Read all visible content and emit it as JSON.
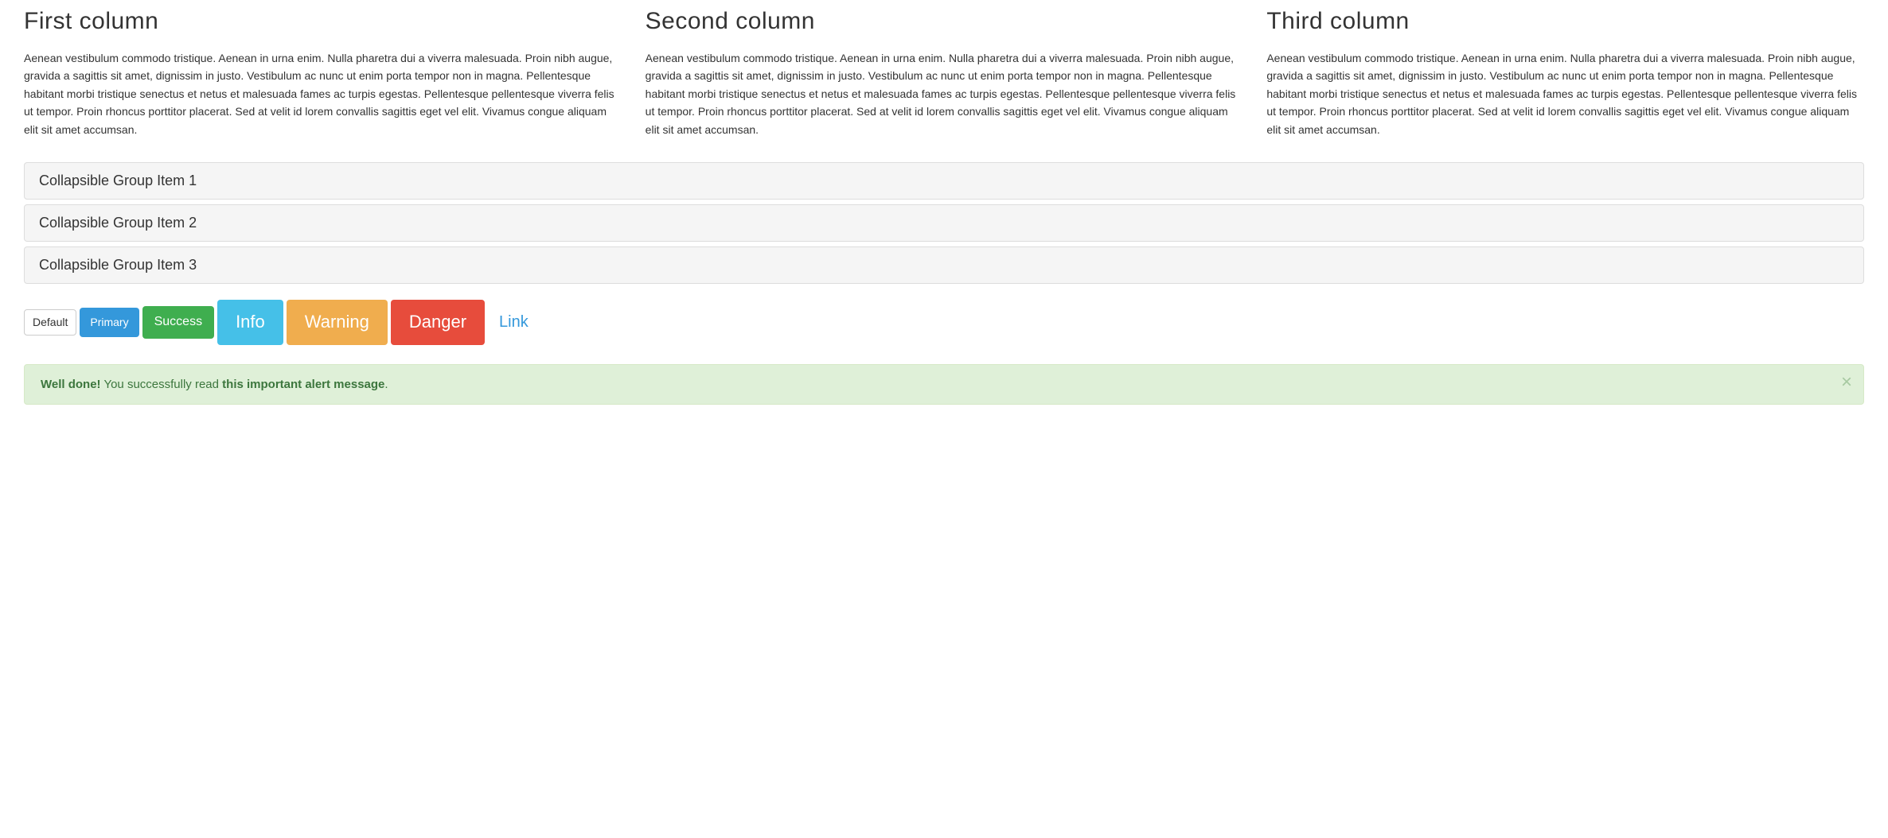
{
  "columns": [
    {
      "title": "First column",
      "body": "Aenean vestibulum commodo tristique. Aenean in urna enim. Nulla pharetra dui a viverra malesuada. Proin nibh augue, gravida a sagittis sit amet, dignissim in justo. Vestibulum ac nunc ut enim porta tempor non in magna. Pellentesque habitant morbi tristique senectus et netus et malesuada fames ac turpis egestas. Pellentesque pellentesque viverra felis ut tempor. Proin rhoncus porttitor placerat. Sed at velit id lorem convallis sagittis eget vel elit. Vivamus congue aliquam elit sit amet accumsan."
    },
    {
      "title": "Second column",
      "body": "Aenean vestibulum commodo tristique. Aenean in urna enim. Nulla pharetra dui a viverra malesuada. Proin nibh augue, gravida a sagittis sit amet, dignissim in justo. Vestibulum ac nunc ut enim porta tempor non in magna. Pellentesque habitant morbi tristique senectus et netus et malesuada fames ac turpis egestas. Pellentesque pellentesque viverra felis ut tempor. Proin rhoncus porttitor placerat. Sed at velit id lorem convallis sagittis eget vel elit. Vivamus congue aliquam elit sit amet accumsan."
    },
    {
      "title": "Third column",
      "body": "Aenean vestibulum commodo tristique. Aenean in urna enim. Nulla pharetra dui a viverra malesuada. Proin nibh augue, gravida a sagittis sit amet, dignissim in justo. Vestibulum ac nunc ut enim porta tempor non in magna. Pellentesque habitant morbi tristique senectus et netus et malesuada fames ac turpis egestas. Pellentesque pellentesque viverra felis ut tempor. Proin rhoncus porttitor placerat. Sed at velit id lorem convallis sagittis eget vel elit. Vivamus congue aliquam elit sit amet accumsan."
    }
  ],
  "accordion": [
    "Collapsible Group Item 1",
    "Collapsible Group Item 2",
    "Collapsible Group Item 3"
  ],
  "buttons": {
    "default": "Default",
    "primary": "Primary",
    "success": "Success",
    "info": "Info",
    "warning": "Warning",
    "danger": "Danger",
    "link": "Link"
  },
  "alert": {
    "strong": "Well done!",
    "middle": " You successfully read ",
    "bold2": "this important alert message",
    "end": "."
  }
}
